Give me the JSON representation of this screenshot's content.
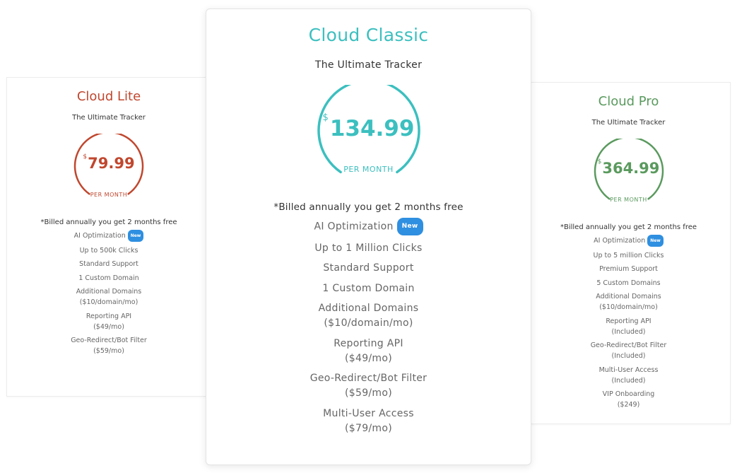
{
  "plans": {
    "lite": {
      "name": "Cloud Lite",
      "tagline": "The Ultimate Tracker",
      "currency": "$",
      "price": "79.99",
      "period": "PER MONTH",
      "billing_note": "*Billed annually you get 2 months free",
      "accent_color": "#c0472e",
      "features": [
        {
          "line1": "AI Optimization",
          "badge": "New"
        },
        {
          "line1": "Up to 500k Clicks"
        },
        {
          "line1": "Standard Support"
        },
        {
          "line1": "1 Custom Domain"
        },
        {
          "line1": "Additional Domains",
          "line2": "($10/domain/mo)"
        },
        {
          "line1": "Reporting API",
          "line2": "($49/mo)"
        },
        {
          "line1": "Geo-Redirect/Bot Filter",
          "line2": "($59/mo)"
        }
      ]
    },
    "classic": {
      "name": "Cloud Classic",
      "tagline": "The Ultimate Tracker",
      "currency": "$",
      "price": "134.99",
      "period": "PER MONTH",
      "billing_note": "*Billed annually you get 2 months free",
      "accent_color": "#3cbfbf",
      "features": [
        {
          "line1": "AI Optimization",
          "badge": "New"
        },
        {
          "line1": "Up to 1 Million Clicks"
        },
        {
          "line1": "Standard Support"
        },
        {
          "line1": "1 Custom Domain"
        },
        {
          "line1": "Additional Domains",
          "line2": "($10/domain/mo)"
        },
        {
          "line1": "Reporting API",
          "line2": "($49/mo)"
        },
        {
          "line1": "Geo-Redirect/Bot Filter",
          "line2": "($59/mo)"
        },
        {
          "line1": "Multi-User Access",
          "line2": "($79/mo)"
        }
      ]
    },
    "pro": {
      "name": "Cloud Pro",
      "tagline": "The Ultimate Tracker",
      "currency": "$",
      "price": "364.99",
      "period": "PER MONTH",
      "billing_note": "*Billed annually you get 2 months free",
      "accent_color": "#5a9a5e",
      "features": [
        {
          "line1": "AI Optimization",
          "badge": "New"
        },
        {
          "line1": "Up to 5 million Clicks"
        },
        {
          "line1": "Premium Support"
        },
        {
          "line1": "5 Custom Domains"
        },
        {
          "line1": "Additional Domains",
          "line2": "($10/domain/mo)"
        },
        {
          "line1": "Reporting API",
          "line2": "(Included)"
        },
        {
          "line1": "Geo-Redirect/Bot Filter",
          "line2": "(Included)"
        },
        {
          "line1": "Multi-User Access",
          "line2": "(Included)"
        },
        {
          "line1": "VIP Onboarding",
          "line2": "($249)"
        }
      ]
    }
  },
  "badge_color": "#2f8fe0"
}
